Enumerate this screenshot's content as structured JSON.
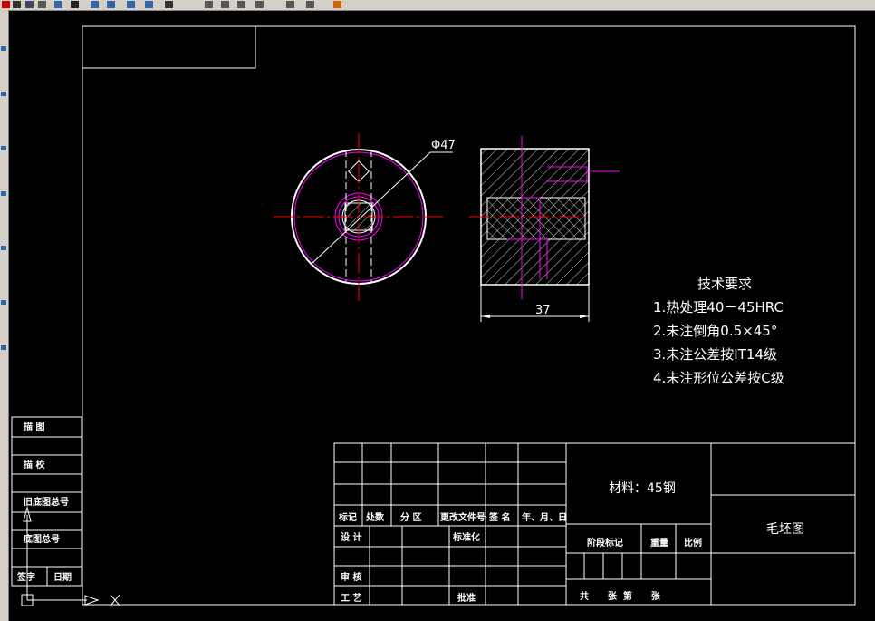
{
  "drawing": {
    "dim_diameter": "Φ47",
    "dim_length": "37"
  },
  "tech_req": {
    "title": "技术要求",
    "items": [
      "1.热处理40－45HRC",
      "2.未注倒角0.5×45°",
      "3.未注公差按IT14级",
      "4.未注形位公差按C级"
    ]
  },
  "title_block": {
    "revision_headers": [
      "标记",
      "处数",
      "分 区",
      "更改文件号",
      "签 名",
      "年、月、日"
    ],
    "role_design": "设 计",
    "role_standard": "标准化",
    "role_review": "审 核",
    "role_process": "工 艺",
    "role_approve": "批准",
    "material": "材料：45钢",
    "stage_mark": "阶段标记",
    "weight": "重量",
    "scale": "比例",
    "sheets": "共      张  第      张",
    "drawing_name": "毛坯图"
  },
  "side_block": {
    "labels": [
      "描 图",
      "描 校",
      "旧底图总号",
      "底图总号",
      "签字",
      "日期"
    ]
  },
  "colors": {
    "background": "#000000",
    "outline": "#ffffff",
    "centerline": "#ff0000",
    "hidden_features": "#ff00ff",
    "toolbar": "#d4d0c8"
  }
}
